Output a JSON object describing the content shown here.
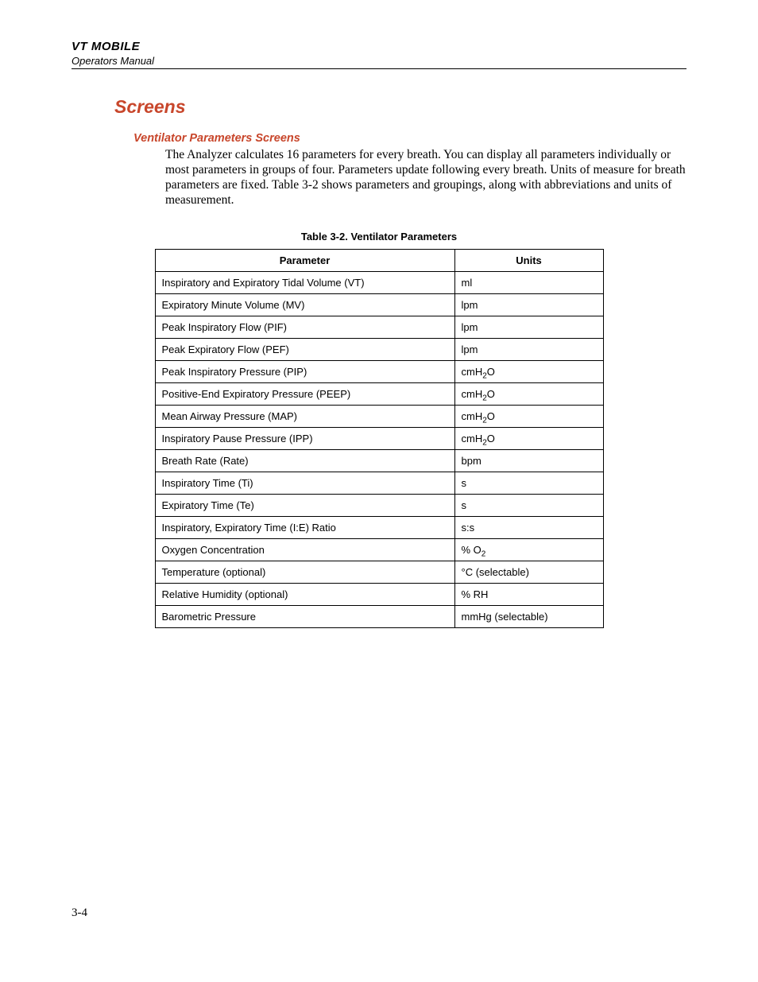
{
  "header": {
    "title": "VT MOBILE",
    "subtitle": "Operators Manual"
  },
  "section": {
    "title": "Screens",
    "subsection": "Ventilator Parameters Screens",
    "paragraph": "The Analyzer calculates 16 parameters for every breath. You can display all parameters individually or most parameters in groups of four. Parameters update following every breath. Units of measure for breath parameters are fixed. Table 3-2 shows parameters and groupings, along with abbreviations and units of measurement."
  },
  "table": {
    "caption": "Table 3-2. Ventilator Parameters",
    "columns": [
      "Parameter",
      "Units"
    ],
    "rows": [
      {
        "param": "Inspiratory and Expiratory Tidal Volume (VT)",
        "units": "ml"
      },
      {
        "param": "Expiratory Minute Volume (MV)",
        "units": "lpm"
      },
      {
        "param": "Peak Inspiratory Flow (PIF)",
        "units": "lpm"
      },
      {
        "param": "Peak Expiratory Flow (PEF)",
        "units": "lpm"
      },
      {
        "param": "Peak Inspiratory Pressure (PIP)",
        "units_html": "cmH<sub>2</sub>O",
        "units": "cmH2O"
      },
      {
        "param": "Positive-End Expiratory Pressure (PEEP)",
        "units_html": "cmH<sub>2</sub>O",
        "units": "cmH2O"
      },
      {
        "param": "Mean Airway Pressure (MAP)",
        "units_html": "cmH<sub>2</sub>O",
        "units": "cmH2O"
      },
      {
        "param": "Inspiratory Pause Pressure (IPP)",
        "units_html": "cmH<sub>2</sub>O",
        "units": "cmH2O"
      },
      {
        "param": "Breath Rate (Rate)",
        "units": "bpm"
      },
      {
        "param": "Inspiratory Time (Ti)",
        "units": "s"
      },
      {
        "param": "Expiratory Time (Te)",
        "units": "s"
      },
      {
        "param": "Inspiratory, Expiratory Time (I:E) Ratio",
        "units": "s:s"
      },
      {
        "param": "Oxygen Concentration",
        "units_html": "% O<sub>2</sub>",
        "units": "% O2"
      },
      {
        "param": "Temperature (optional)",
        "units": "°C (selectable)"
      },
      {
        "param": "Relative Humidity (optional)",
        "units": "% RH"
      },
      {
        "param": "Barometric Pressure",
        "units": "mmHg (selectable)"
      }
    ]
  },
  "page_number": "3-4"
}
